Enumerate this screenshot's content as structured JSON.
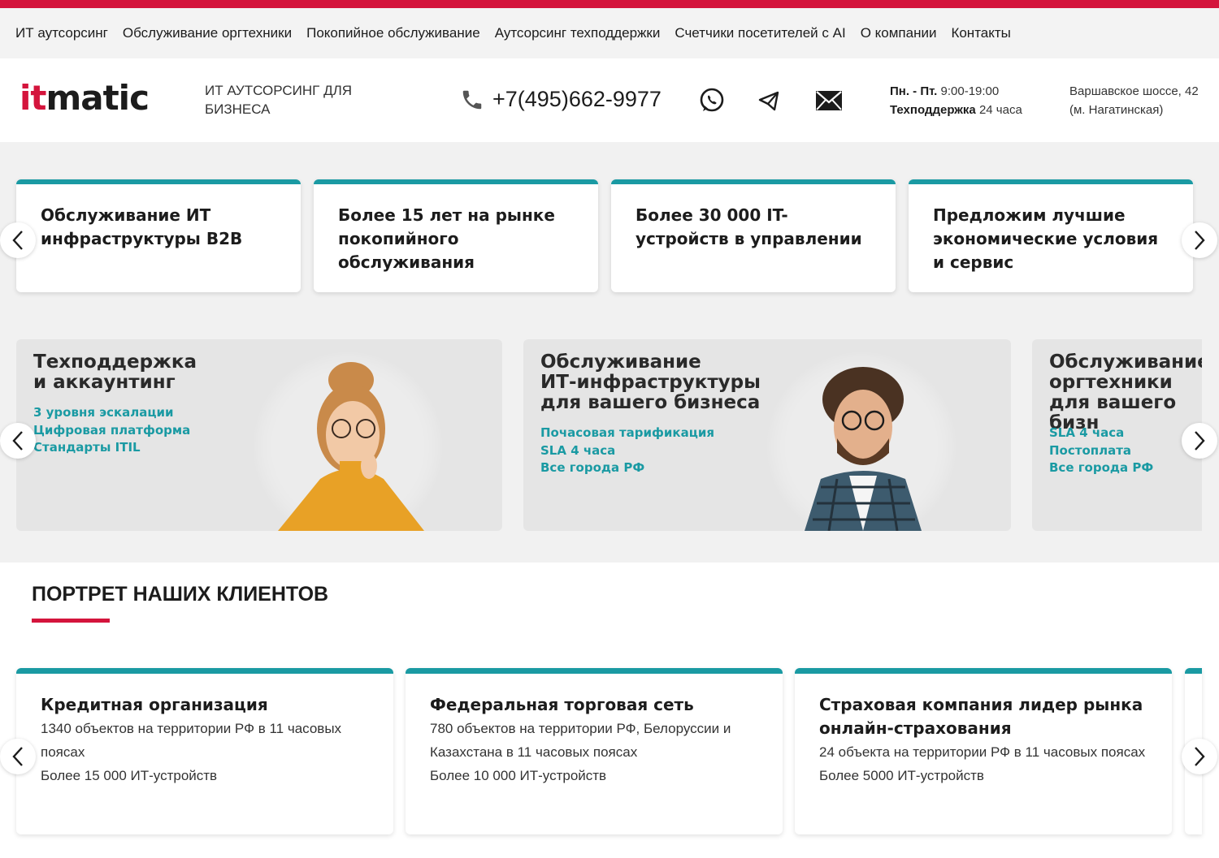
{
  "colors": {
    "brand_red": "#d4143c",
    "accent_teal": "#1a9aa3",
    "text": "#1c1c1c"
  },
  "topnav": {
    "items": [
      "ИТ аутсорсинг",
      "Обслуживание оргтехники",
      "Покопийное обслуживание",
      "Аутсорсинг техподдержки",
      "Счетчики посетителей с AI",
      "О компании",
      "Контакты"
    ]
  },
  "header": {
    "logo_it": "it",
    "logo_matic": "matic",
    "tagline": "ИТ АУТСОРСИНГ ДЛЯ БИЗНЕСА",
    "phone": "+7(495)662-9977",
    "icons": [
      "phone-icon",
      "whatsapp-icon",
      "telegram-icon",
      "mail-icon"
    ],
    "hours_days_label": "Пн. - Пт.",
    "hours_days_value": "9:00-19:00",
    "support_label": "Техподдержка",
    "support_value": "24 часа",
    "address_line1": "Варшавское шоссе, 42",
    "address_line2": "(м. Нагатинская)"
  },
  "features": [
    "Обслуживание ИТ инфраструктуры B2B",
    "Более 15 лет на рынке покопийного обслуживания",
    "Более 30 000 IT-устройств в управлении",
    "Предложим лучшие экономические условия и сервис"
  ],
  "promos": [
    {
      "title": "Техподдержка\nи аккаунтинг",
      "bullets": [
        "3 уровня эскалации",
        "Цифровая платформа",
        "Стандарты ITIL"
      ]
    },
    {
      "title": "Обслуживание\nИТ-инфраструктуры\nдля вашего бизнеса",
      "bullets": [
        "Почасовая тарификация",
        "SLA 4 часа",
        "Все города РФ"
      ]
    },
    {
      "title": "Обслуживание\nоргтехники\nдля вашего бизн",
      "bullets": [
        "SLA 4 часа",
        "Постоплата",
        "Все города РФ"
      ]
    }
  ],
  "clients_section": {
    "title": "ПОРТРЕТ НАШИХ КЛИЕНТОВ",
    "cards": [
      {
        "title": "Кредитная организация",
        "line1": "1340 объектов на территории РФ в 11 часовых поясах",
        "line2": "Более 15 000 ИТ-устройств"
      },
      {
        "title": "Федеральная торговая сеть",
        "line1": "780 объектов на территории РФ, Белоруссии и Казахстана в 11 часовых поясах",
        "line2": "Более 10 000 ИТ-устройств"
      },
      {
        "title": "Страховая компания лидер рынка онлайн-страхования",
        "line1": "24 объекта на территории РФ в 11 часовых поясах",
        "line2": "Более 5000 ИТ-устройств"
      }
    ]
  }
}
